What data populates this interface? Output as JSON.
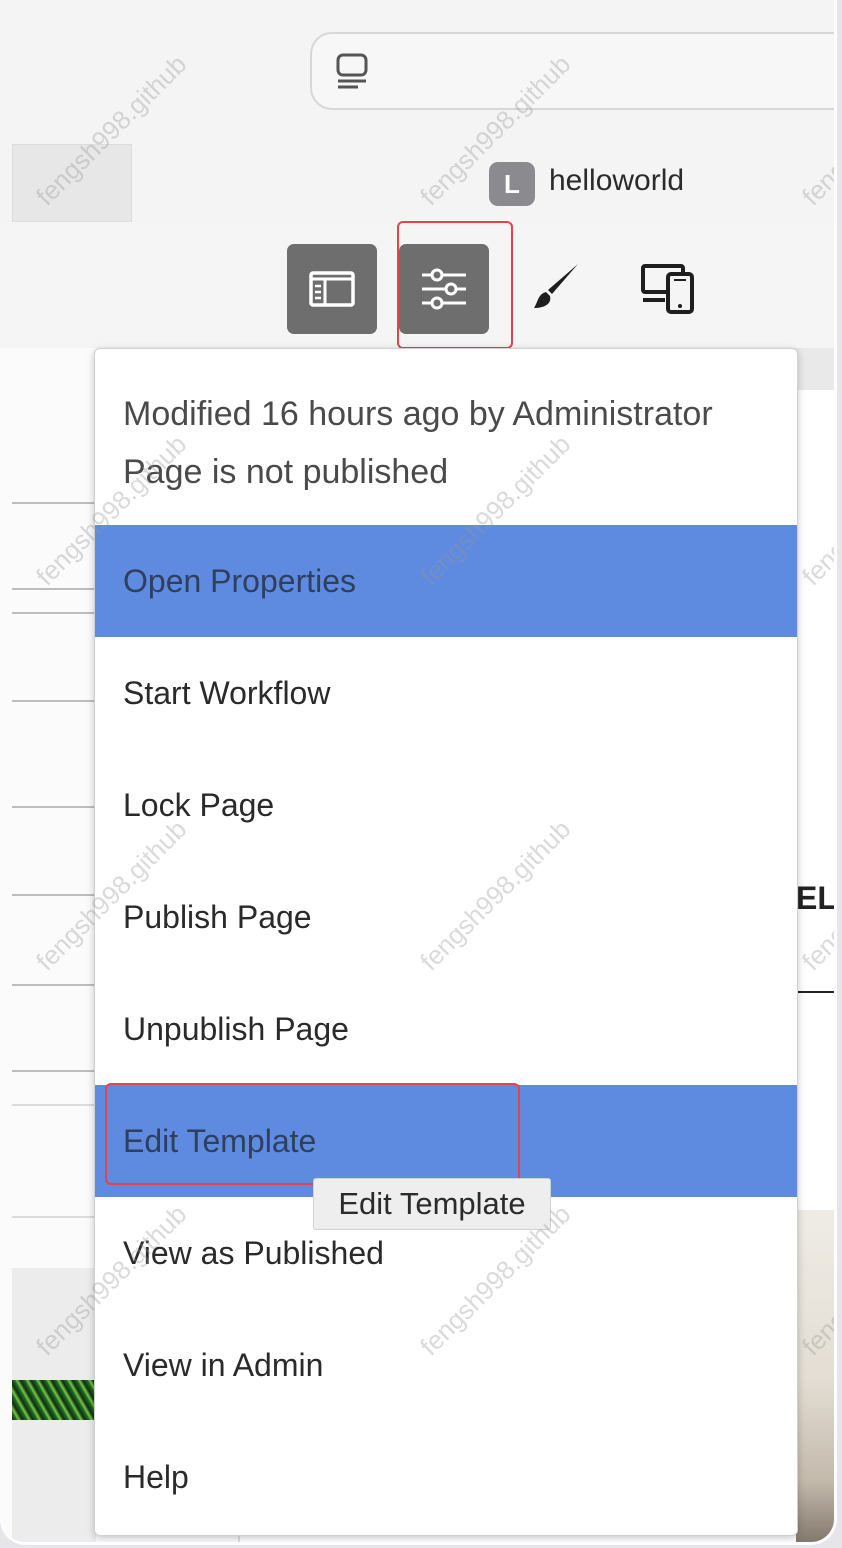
{
  "header": {
    "user_initial": "L",
    "user_name": "helloworld"
  },
  "toolbar": {
    "buttons": [
      {
        "name": "side-panel",
        "icon": "panel-icon",
        "active": true
      },
      {
        "name": "page-information",
        "icon": "sliders-icon",
        "active": true
      },
      {
        "name": "styles",
        "icon": "brush-icon",
        "active": false
      },
      {
        "name": "emulator",
        "icon": "devices-icon",
        "active": false
      }
    ]
  },
  "menu": {
    "status_line1": "Modified 16 hours ago by Administrator",
    "status_line2": "Page is not published",
    "items": [
      {
        "label": "Open Properties",
        "highlighted": true
      },
      {
        "label": "Start Workflow",
        "highlighted": false
      },
      {
        "label": "Lock Page",
        "highlighted": false
      },
      {
        "label": "Publish Page",
        "highlighted": false
      },
      {
        "label": "Unpublish Page",
        "highlighted": false
      },
      {
        "label": "Edit Template",
        "highlighted": true
      },
      {
        "label": "View as Published",
        "highlighted": false
      },
      {
        "label": "View in Admin",
        "highlighted": false
      },
      {
        "label": "Help",
        "highlighted": false
      }
    ]
  },
  "tooltip": {
    "text": "Edit Template"
  },
  "canvas": {
    "partial_heading": "EL"
  },
  "watermark": "fengsh998.github",
  "colors": {
    "highlight": "#5e8be0",
    "annotation_box": "#e5424a",
    "toolbar_button": "#6e6e6e"
  }
}
